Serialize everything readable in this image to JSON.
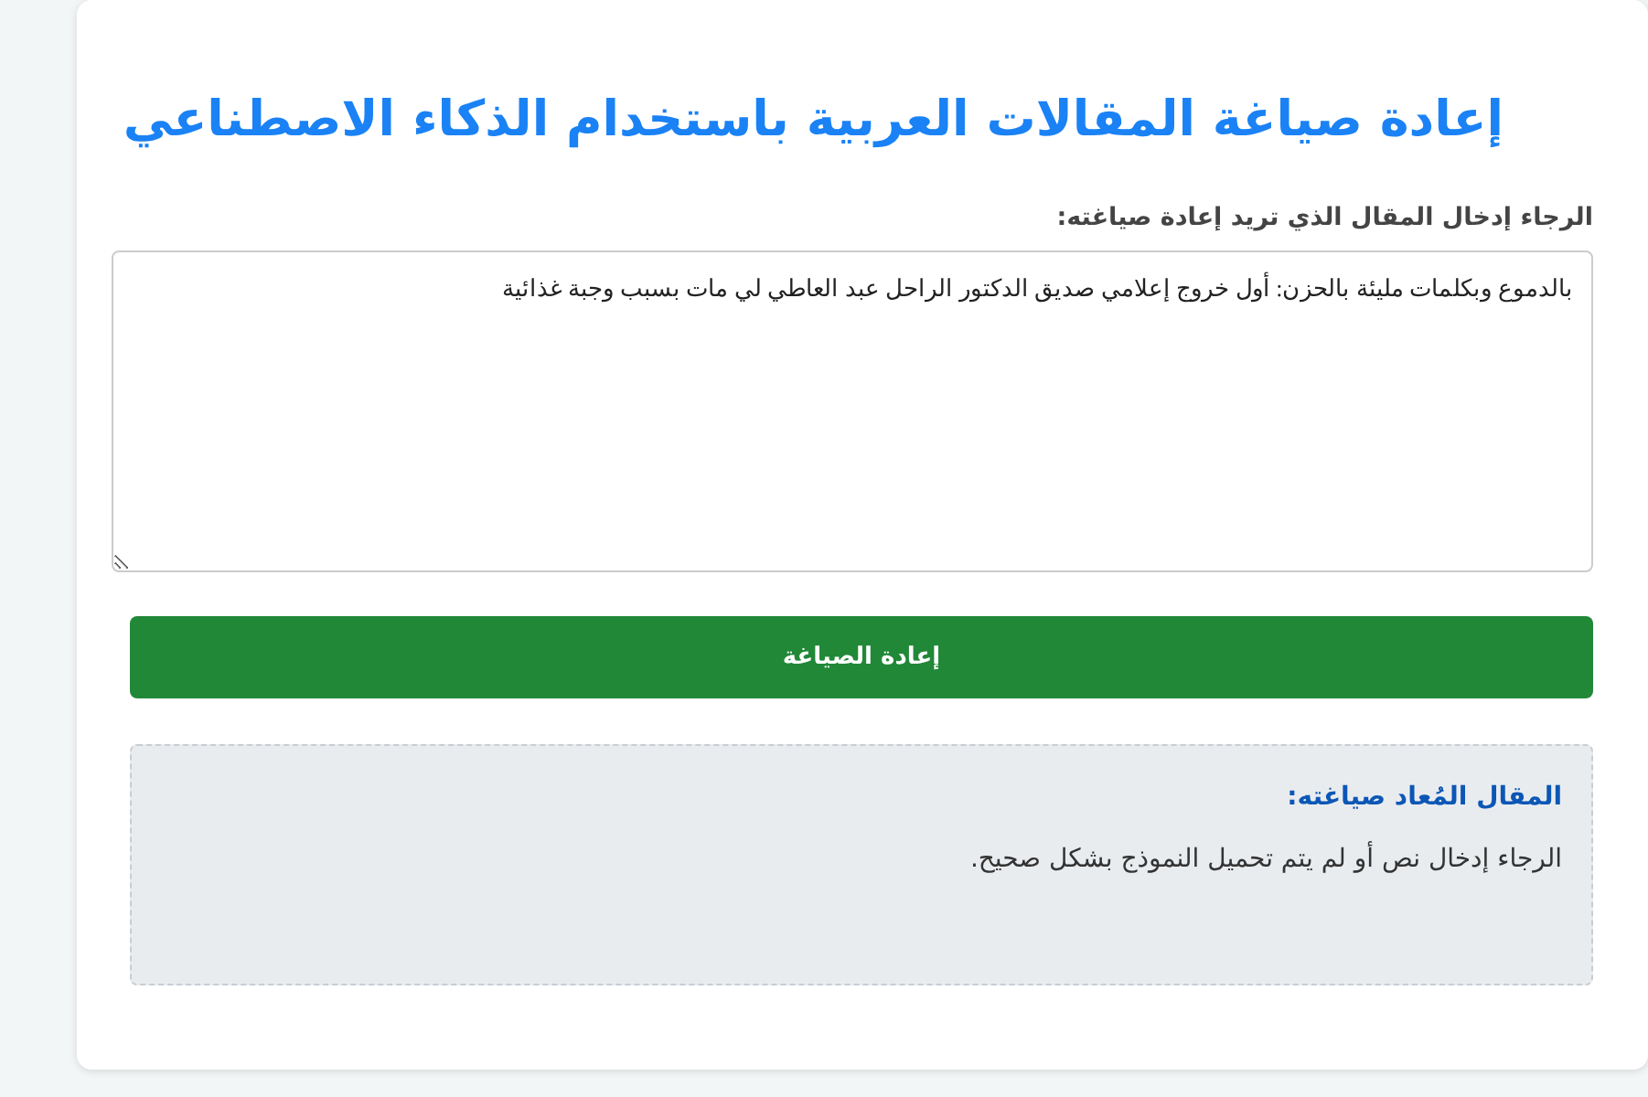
{
  "title": "إعادة صياغة المقالات العربية باستخدام الذكاء الاصطناعي",
  "input": {
    "label": "الرجاء إدخال المقال الذي تريد إعادة صياغته:",
    "value": "بالدموع وبكلمات مليئة بالحزن: أول خروج إعلامي صديق الدكتور الراحل عبد العاطي لي مات بسبب وجبة غذائية"
  },
  "submit_button": "إعادة الصياغة",
  "result": {
    "heading": "المقال المُعاد صياغته:",
    "text": "الرجاء إدخال نص أو لم يتم تحميل النموذج بشكل صحيح."
  }
}
